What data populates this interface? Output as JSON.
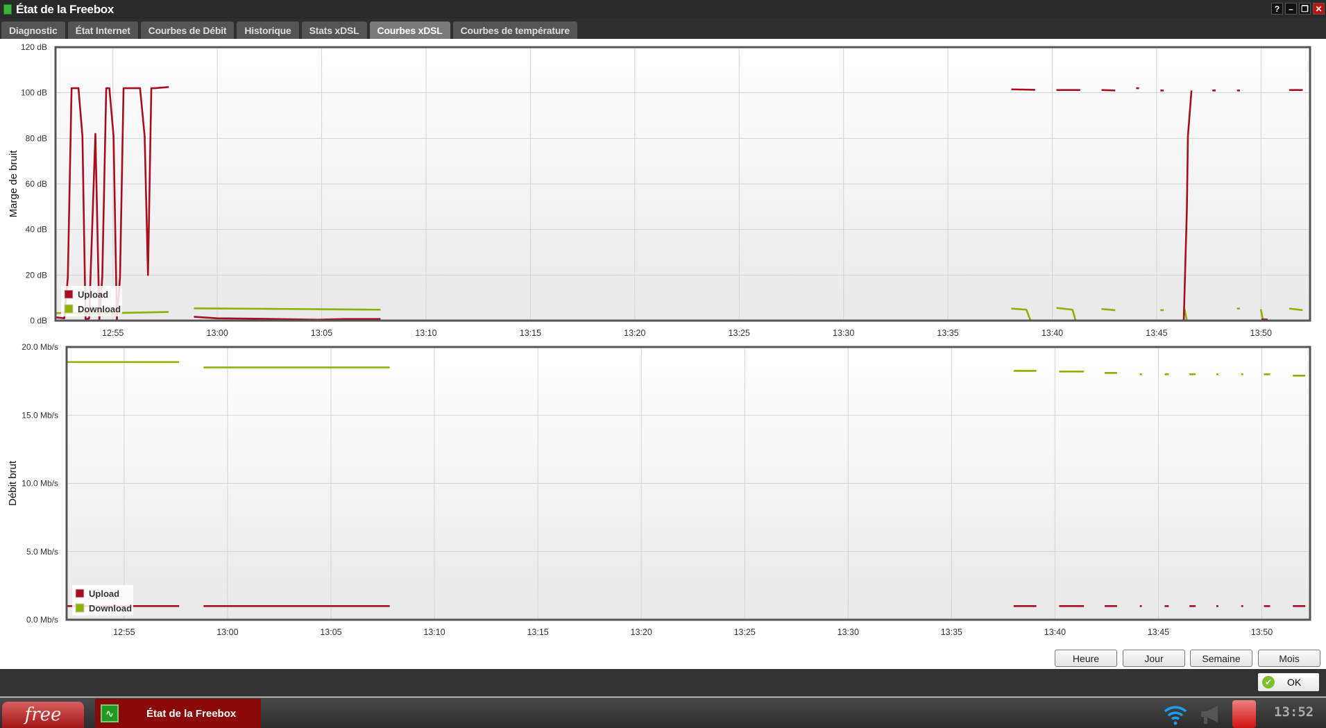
{
  "window": {
    "title": "État de la Freebox",
    "controls": [
      "?",
      "–",
      "❐",
      "✕"
    ]
  },
  "tabs": [
    {
      "label": "Diagnostic",
      "active": false
    },
    {
      "label": "État Internet",
      "active": false
    },
    {
      "label": "Courbes de Débit",
      "active": false
    },
    {
      "label": "Historique",
      "active": false
    },
    {
      "label": "Stats xDSL",
      "active": false
    },
    {
      "label": "Courbes xDSL",
      "active": true
    },
    {
      "label": "Courbes de température",
      "active": false
    }
  ],
  "range_buttons": [
    "Heure",
    "Jour",
    "Semaine",
    "Mois"
  ],
  "ok_label": "OK",
  "taskbar": {
    "logo": "free",
    "window_label": "État de la Freebox",
    "clock": "13:52",
    "tray_icons": [
      "wifi-icon",
      "megaphone-icon",
      "freebox-alert-icon"
    ]
  },
  "colors": {
    "upload": "#a50d20",
    "download": "#8db100"
  },
  "chart_data": [
    {
      "type": "line",
      "ylabel": "Marge de bruit",
      "yunit": "dB",
      "ylim": [
        0,
        120
      ],
      "yticks": [
        0,
        20,
        40,
        60,
        80,
        100,
        120
      ],
      "ytick_labels": [
        "0 dB",
        "20 dB",
        "40 dB",
        "60 dB",
        "80 dB",
        "100 dB",
        "120 dB"
      ],
      "x_unit": "minutes after 12:00",
      "xlim": [
        52.25,
        112.35
      ],
      "xticks": [
        55,
        60,
        65,
        70,
        75,
        80,
        85,
        90,
        95,
        100,
        105,
        110
      ],
      "xtick_labels": [
        "12:55",
        "13:00",
        "13:05",
        "13:10",
        "13:15",
        "13:20",
        "13:25",
        "13:30",
        "13:35",
        "13:40",
        "13:45",
        "13:50"
      ],
      "legend": {
        "position": "bottom-left",
        "entries": [
          "Upload",
          "Download"
        ]
      },
      "grid": true,
      "series": [
        {
          "name": "Upload",
          "segments": [
            [
              [
                52.23,
                1.5
              ],
              [
                52.67,
                1
              ],
              [
                52.84,
                19
              ],
              [
                53.02,
                102
              ],
              [
                53.35,
                102
              ],
              [
                53.54,
                81
              ],
              [
                53.69,
                0.5
              ],
              [
                53.86,
                1
              ],
              [
                54.16,
                82
              ],
              [
                54.35,
                0.5
              ],
              [
                54.49,
                19
              ],
              [
                54.68,
                102
              ],
              [
                54.83,
                102
              ],
              [
                55.03,
                81
              ],
              [
                55.19,
                0.5
              ],
              [
                55.34,
                19
              ],
              [
                55.51,
                102
              ],
              [
                56.3,
                102
              ],
              [
                56.52,
                81
              ],
              [
                56.68,
                20
              ],
              [
                56.84,
                102
              ],
              [
                57.0,
                102
              ],
              [
                57.67,
                102.5
              ]
            ],
            [
              [
                58.88,
                1.7
              ],
              [
                60.0,
                1
              ],
              [
                62.27,
                0.8
              ],
              [
                64.81,
                0.4
              ],
              [
                66.08,
                0.7
              ],
              [
                67.82,
                0.7
              ]
            ],
            [
              [
                98.04,
                101.5
              ],
              [
                99.18,
                101.3
              ]
            ],
            [
              [
                100.2,
                101.2
              ],
              [
                101.34,
                101.2
              ]
            ],
            [
              [
                102.36,
                101.2
              ],
              [
                103.02,
                101
              ]
            ],
            [
              [
                104.02,
                102
              ],
              [
                104.16,
                102
              ]
            ],
            [
              [
                105.18,
                101
              ],
              [
                105.34,
                101
              ]
            ],
            [
              [
                106.3,
                0
              ],
              [
                106.45,
                49
              ],
              [
                106.5,
                81
              ],
              [
                106.67,
                101
              ]
            ],
            [
              [
                107.67,
                101
              ],
              [
                107.83,
                101
              ]
            ],
            [
              [
                108.85,
                101
              ],
              [
                108.99,
                101
              ]
            ],
            [
              [
                110.02,
                0.5
              ],
              [
                110.32,
                0.5
              ]
            ],
            [
              [
                111.35,
                101.2
              ],
              [
                112.0,
                101.2
              ]
            ]
          ]
        },
        {
          "name": "Download",
          "segments": [
            [
              [
                52.23,
                3.3
              ],
              [
                55.47,
                3.4
              ],
              [
                57.67,
                3.8
              ]
            ],
            [
              [
                58.88,
                5.4
              ],
              [
                63.54,
                5.1
              ],
              [
                67.82,
                4.8
              ]
            ],
            [
              [
                98.04,
                5.3
              ],
              [
                98.76,
                4.8
              ],
              [
                98.96,
                0
              ]
            ],
            [
              [
                100.2,
                5.6
              ],
              [
                100.97,
                4.8
              ],
              [
                101.12,
                0
              ]
            ],
            [
              [
                102.36,
                5.1
              ],
              [
                103.02,
                4.6
              ]
            ],
            [
              [
                105.18,
                4.6
              ],
              [
                105.34,
                4.6
              ]
            ],
            [
              [
                106.34,
                5
              ],
              [
                106.45,
                0
              ]
            ],
            [
              [
                108.85,
                5.3
              ],
              [
                108.99,
                5.3
              ]
            ],
            [
              [
                109.99,
                5
              ],
              [
                110.1,
                0
              ]
            ],
            [
              [
                111.35,
                5.3
              ],
              [
                112.0,
                4.6
              ]
            ]
          ]
        }
      ]
    },
    {
      "type": "line",
      "ylabel": "Débit brut",
      "yunit": "Mb/s",
      "ylim": [
        0,
        20
      ],
      "yticks": [
        0,
        5,
        10,
        15,
        20
      ],
      "ytick_labels": [
        "0.0 Mb/s",
        "5.0 Mb/s",
        "10.0 Mb/s",
        "15.0 Mb/s",
        "20.0 Mb/s"
      ],
      "x_unit": "minutes after 12:00",
      "xlim": [
        52.22,
        112.33
      ],
      "xticks": [
        55,
        60,
        65,
        70,
        75,
        80,
        85,
        90,
        95,
        100,
        105,
        110
      ],
      "xtick_labels": [
        "12:55",
        "13:00",
        "13:05",
        "13:10",
        "13:15",
        "13:20",
        "13:25",
        "13:30",
        "13:35",
        "13:40",
        "13:45",
        "13:50"
      ],
      "legend": {
        "position": "bottom-left",
        "entries": [
          "Upload",
          "Download"
        ]
      },
      "grid": true,
      "series": [
        {
          "name": "Upload",
          "segments": [
            [
              [
                52.22,
                1.0
              ],
              [
                57.66,
                1.0
              ]
            ],
            [
              [
                58.84,
                1.0
              ],
              [
                67.84,
                1.0
              ]
            ],
            [
              [
                98.0,
                1.0
              ],
              [
                99.1,
                1.0
              ]
            ],
            [
              [
                100.2,
                1.0
              ],
              [
                101.4,
                1.0
              ]
            ],
            [
              [
                102.4,
                1.0
              ],
              [
                103.0,
                1.0
              ]
            ],
            [
              [
                104.1,
                1.0
              ],
              [
                104.2,
                1.0
              ]
            ],
            [
              [
                105.3,
                1.0
              ],
              [
                105.5,
                1.0
              ]
            ],
            [
              [
                106.5,
                1.0
              ],
              [
                106.8,
                1.0
              ]
            ],
            [
              [
                107.8,
                1.0
              ],
              [
                107.9,
                1.0
              ]
            ],
            [
              [
                109.0,
                1.0
              ],
              [
                109.1,
                1.0
              ]
            ],
            [
              [
                110.1,
                1.0
              ],
              [
                110.4,
                1.0
              ]
            ],
            [
              [
                111.5,
                1.0
              ],
              [
                112.1,
                1.0
              ]
            ]
          ]
        },
        {
          "name": "Download",
          "segments": [
            [
              [
                52.22,
                18.9
              ],
              [
                57.66,
                18.9
              ]
            ],
            [
              [
                58.84,
                18.5
              ],
              [
                67.84,
                18.5
              ]
            ],
            [
              [
                98.0,
                18.25
              ],
              [
                99.1,
                18.25
              ]
            ],
            [
              [
                100.2,
                18.2
              ],
              [
                101.4,
                18.2
              ]
            ],
            [
              [
                102.4,
                18.1
              ],
              [
                103.0,
                18.1
              ]
            ],
            [
              [
                104.1,
                18.0
              ],
              [
                104.2,
                18.0
              ]
            ],
            [
              [
                105.3,
                18.0
              ],
              [
                105.5,
                18.0
              ]
            ],
            [
              [
                106.5,
                18.0
              ],
              [
                106.8,
                18.0
              ]
            ],
            [
              [
                107.8,
                18.0
              ],
              [
                107.9,
                18.0
              ]
            ],
            [
              [
                109.0,
                18.0
              ],
              [
                109.1,
                18.0
              ]
            ],
            [
              [
                110.1,
                18.0
              ],
              [
                110.4,
                18.0
              ]
            ],
            [
              [
                111.5,
                17.9
              ],
              [
                112.1,
                17.9
              ]
            ]
          ]
        }
      ]
    }
  ]
}
